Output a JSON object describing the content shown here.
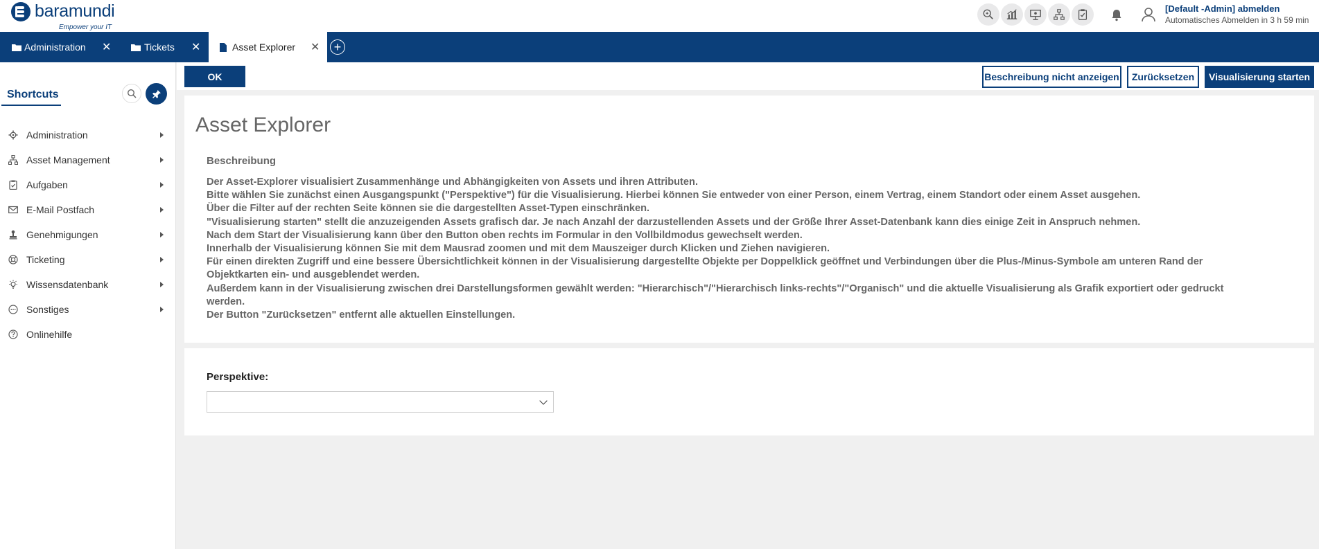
{
  "header": {
    "logo_text": "baramundi",
    "logo_tagline": "Empower your IT",
    "toolbar_icons": [
      "zoom-search-icon",
      "chart-icon",
      "presentation-icon",
      "hierarchy-icon",
      "clipboard-check-icon"
    ],
    "user_line": "[Default -Admin] abmelden",
    "auto_logout": "Automatisches Abmelden in 3 h 59 min"
  },
  "tabs": [
    {
      "label": "Administration",
      "active": false
    },
    {
      "label": "Tickets",
      "active": false
    },
    {
      "label": "Asset Explorer",
      "active": true
    }
  ],
  "sidebar": {
    "title": "Shortcuts",
    "items": [
      {
        "label": "Administration",
        "icon": "gear-icon",
        "has_submenu": true
      },
      {
        "label": "Asset Management",
        "icon": "hierarchy-icon",
        "has_submenu": true
      },
      {
        "label": "Aufgaben",
        "icon": "clipboard-icon",
        "has_submenu": true
      },
      {
        "label": "E-Mail Postfach",
        "icon": "mail-icon",
        "has_submenu": true
      },
      {
        "label": "Genehmigungen",
        "icon": "stamp-icon",
        "has_submenu": true
      },
      {
        "label": "Ticketing",
        "icon": "support-icon",
        "has_submenu": true
      },
      {
        "label": "Wissensdatenbank",
        "icon": "lightbulb-icon",
        "has_submenu": true
      },
      {
        "label": "Sonstiges",
        "icon": "more-icon",
        "has_submenu": true
      },
      {
        "label": "Onlinehilfe",
        "icon": "help-icon",
        "has_submenu": false
      }
    ]
  },
  "actions": {
    "ok": "OK",
    "hide_description": "Beschreibung nicht anzeigen",
    "reset": "Zurücksetzen",
    "start": "Visualisierung starten"
  },
  "main": {
    "title": "Asset Explorer",
    "description_heading": "Beschreibung",
    "description_lines": [
      "Der Asset-Explorer visualisiert Zusammenhänge und Abhängigkeiten von Assets und ihren Attributen.",
      "Bitte wählen Sie zunächst einen Ausgangspunkt (\"Perspektive\") für die Visualisierung. Hierbei können Sie entweder von einer Person, einem Vertrag, einem Standort oder einem Asset ausgehen.",
      "Über die Filter auf der rechten Seite können sie die dargestellten Asset-Typen einschränken.",
      "\"Visualisierung starten\" stellt die anzuzeigenden Assets grafisch dar. Je nach Anzahl der darzustellenden Assets und der Größe Ihrer Asset-Datenbank kann dies einige Zeit in Anspruch nehmen.",
      "Nach dem Start der Visualisierung kann über den Button oben rechts im Formular in den Vollbildmodus gewechselt werden.",
      "Innerhalb der Visualisierung können Sie mit dem Mausrad zoomen und mit dem Mauszeiger durch Klicken und Ziehen navigieren.",
      "Für einen direkten Zugriff und eine bessere Übersichtlichkeit können in der Visualisierung dargestellte Objekte per Doppelklick geöffnet und Verbindungen über die Plus-/Minus-Symbole am unteren Rand der Objektkarten ein- und ausgeblendet werden.",
      "Außerdem kann in der Visualisierung zwischen drei Darstellungsformen gewählt werden: \"Hierarchisch\"/\"Hierarchisch links-rechts\"/\"Organisch\" und die aktuelle Visualisierung als Grafik exportiert oder gedruckt werden.",
      "Der Button \"Zurücksetzen\" entfernt alle aktuellen Einstellungen."
    ],
    "perspective_label": "Perspektive:",
    "perspective_value": ""
  },
  "colors": {
    "brand": "#0b3f7a",
    "background": "#f0f0f0",
    "text_muted": "#666666"
  }
}
